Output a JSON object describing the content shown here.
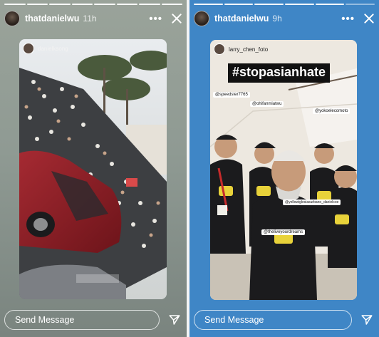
{
  "left_story": {
    "username": "thatdanielwu",
    "time": "11h",
    "reposted_from": "danielksong",
    "message_placeholder": "Send Message",
    "progress_segments": 8,
    "progress_done": 8
  },
  "right_story": {
    "username": "thatdanielwu",
    "time": "9h",
    "reposted_from": "larry_chen_foto",
    "hashtag": "#stopasianhate",
    "tags": [
      "@speedster7765",
      "@ohifanmiatwu",
      "@yokoelecomoto",
      "@yellowiglesiasurbano_danielcoe",
      "@theliveyourdreams"
    ],
    "message_placeholder": "Send Message",
    "progress_segments": 6,
    "progress_done": 5
  },
  "colors": {
    "right_background": "#3f86c6",
    "car_red": "#8e1e25",
    "hashtag_bg": "#111111"
  }
}
